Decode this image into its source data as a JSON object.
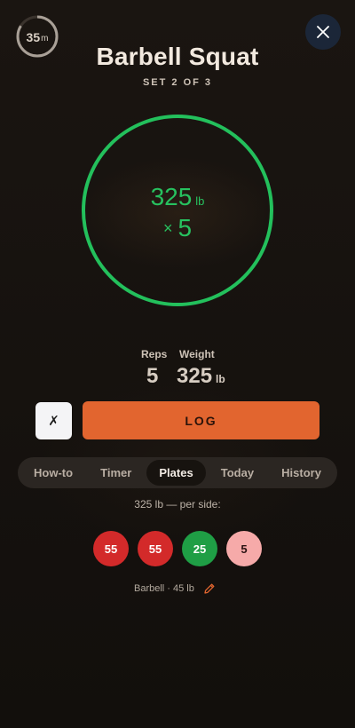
{
  "timer": {
    "value": "35",
    "unit": "m"
  },
  "exercise": {
    "title": "Barbell Squat",
    "set_label": "SET 2 OF 3"
  },
  "ring": {
    "weight": "325",
    "unit": "lb",
    "reps_prefix": "×",
    "reps": "5",
    "color": "#23c05c"
  },
  "inputs": {
    "reps_label": "Reps",
    "weight_label": "Weight",
    "reps_value": "5",
    "weight_value": "325",
    "weight_unit": "lb"
  },
  "actions": {
    "cancel_label": "✗",
    "log_label": "LOG",
    "log_color": "#e2652f"
  },
  "tabs": [
    {
      "label": "How-to",
      "active": false
    },
    {
      "label": "Timer",
      "active": false
    },
    {
      "label": "Plates",
      "active": true
    },
    {
      "label": "Today",
      "active": false
    },
    {
      "label": "History",
      "active": false
    }
  ],
  "plates": {
    "per_side_text": "325 lb — per side:",
    "items": [
      {
        "value": "55",
        "color": "#d32a2a"
      },
      {
        "value": "55",
        "color": "#d32a2a"
      },
      {
        "value": "25",
        "color": "#1f9e45"
      },
      {
        "value": "5",
        "color": "#f6aaa9"
      }
    ],
    "barbell_text": "Barbell · 45 lb"
  },
  "icons": {
    "close": "close-icon",
    "edit": "pencil-icon"
  }
}
